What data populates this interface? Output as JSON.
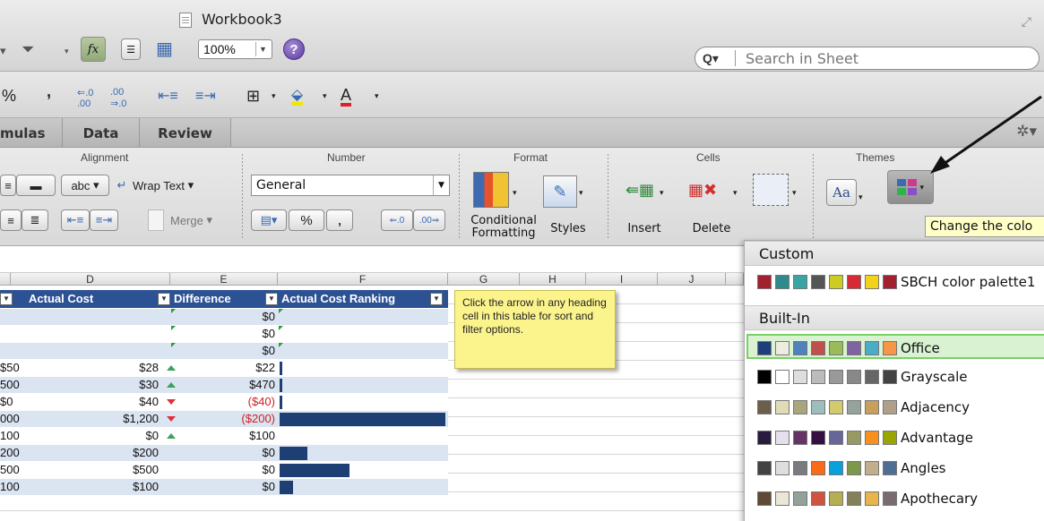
{
  "window": {
    "title": "Workbook3"
  },
  "toolbar": {
    "zoom": "100%",
    "search_placeholder": "Search in Sheet"
  },
  "tabs": [
    {
      "label": "mulas"
    },
    {
      "label": "Data"
    },
    {
      "label": "Review"
    }
  ],
  "ribbon": {
    "groups": {
      "alignment": "Alignment",
      "number": "Number",
      "format": "Format",
      "cells": "Cells",
      "themes": "Themes"
    },
    "abc": "abc",
    "wrap_text": "Wrap Text",
    "merge": "Merge",
    "number_format": "General",
    "percent": "%",
    "comma": ",",
    "conditional_formatting": "Conditional\nFormatting",
    "styles": "Styles",
    "insert": "Insert",
    "delete": "Delete",
    "themes_aa": "Aa"
  },
  "fmtbar": {
    "percent": "%",
    "comma": ",",
    "font_color": "A"
  },
  "columns": [
    "D",
    "E",
    "F",
    "G",
    "H",
    "I",
    "J"
  ],
  "table": {
    "headers": {
      "actual_cost": "Actual Cost",
      "difference": "Difference",
      "ranking": "Actual Cost Ranking"
    },
    "rows": [
      {
        "c": "",
        "d": "",
        "e": "$0",
        "trend": "",
        "rank": 0
      },
      {
        "c": "",
        "d": "",
        "e": "$0",
        "trend": "",
        "rank": 0
      },
      {
        "c": "",
        "d": "",
        "e": "$0",
        "trend": "",
        "rank": 0
      },
      {
        "c": "$50",
        "d": "$28",
        "e": "$22",
        "trend": "up",
        "rank": 0.01
      },
      {
        "c": "500",
        "d": "$30",
        "e": "$470",
        "trend": "up",
        "rank": 0.01
      },
      {
        "c": "$0",
        "d": "$40",
        "e": "($40)",
        "trend": "down",
        "rank": 0.01
      },
      {
        "c": "000",
        "d": "$1,200",
        "e": "($200)",
        "trend": "down",
        "rank": 1.0
      },
      {
        "c": "100",
        "d": "$0",
        "e": "$100",
        "trend": "up",
        "rank": 0
      },
      {
        "c": "200",
        "d": "$200",
        "e": "$0",
        "trend": "",
        "rank": 0.17
      },
      {
        "c": "500",
        "d": "$500",
        "e": "$0",
        "trend": "",
        "rank": 0.42
      },
      {
        "c": "100",
        "d": "$100",
        "e": "$0",
        "trend": "",
        "rank": 0.08
      }
    ]
  },
  "note": "Click the arrow in any heading cell in this table for sort and filter options.",
  "tooltip": "Change the colo",
  "theme_popup": {
    "custom_title": "Custom",
    "builtin_title": "Built-In",
    "custom": [
      {
        "name": "SBCH color palette1",
        "colors": [
          "#a3202e",
          "#2e8a8c",
          "#3aa3a3",
          "#555555",
          "#cccc22",
          "#d82a35",
          "#f2d21b",
          "#a3202e"
        ]
      }
    ],
    "builtin": [
      {
        "name": "Office",
        "selected": true,
        "colors": [
          "#1f3f7a",
          "#eeece1",
          "#4f81bd",
          "#c0504d",
          "#9bbb59",
          "#8064a2",
          "#4bacc6",
          "#f79646"
        ]
      },
      {
        "name": "Grayscale",
        "colors": [
          "#000000",
          "#ffffff",
          "#dddddd",
          "#bbbbbb",
          "#999999",
          "#888888",
          "#666666",
          "#444444"
        ]
      },
      {
        "name": "Adjacency",
        "colors": [
          "#6b5e4a",
          "#dfdcb7",
          "#a9a57c",
          "#9cbebd",
          "#d2cb6c",
          "#95a39d",
          "#c89f5d",
          "#b1a089"
        ]
      },
      {
        "name": "Advantage",
        "colors": [
          "#2a1c3e",
          "#e6dfee",
          "#663366",
          "#330f42",
          "#666699",
          "#999966",
          "#f7901e",
          "#99a500"
        ]
      },
      {
        "name": "Angles",
        "colors": [
          "#434342",
          "#dedede",
          "#797b7e",
          "#f96a1b",
          "#08a1d9",
          "#7c984a",
          "#c2ad8d",
          "#506e94"
        ]
      },
      {
        "name": "Apothecary",
        "colors": [
          "#5f4a36",
          "#ebe7d6",
          "#93a299",
          "#cf543f",
          "#b5ae53",
          "#848058",
          "#e8b54d",
          "#786c71"
        ]
      }
    ]
  }
}
